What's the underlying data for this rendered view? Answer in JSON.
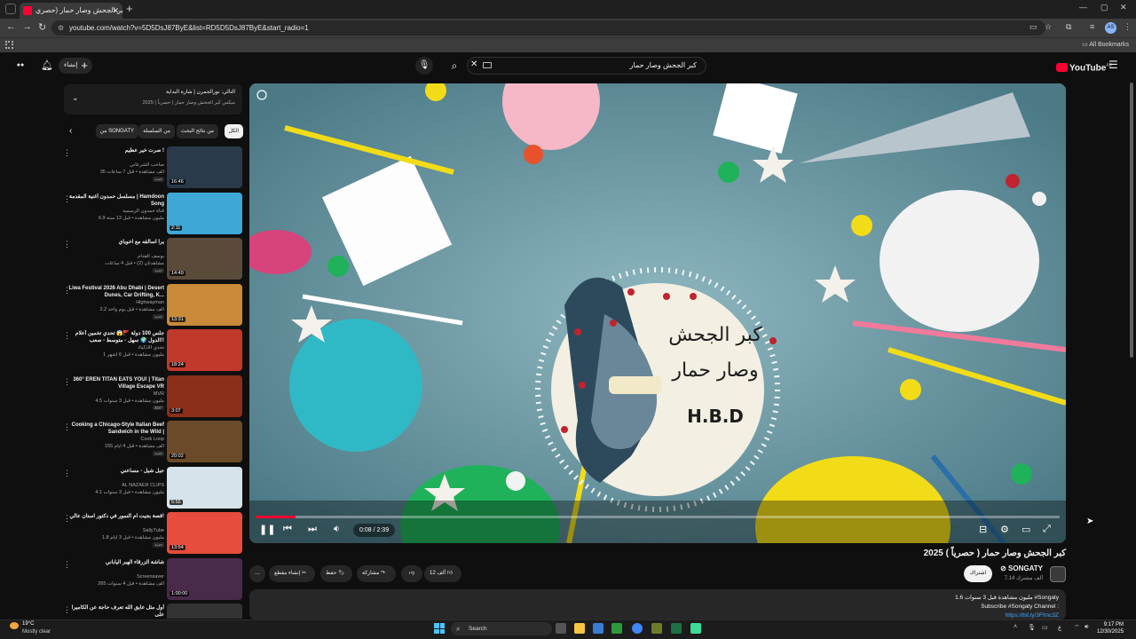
{
  "browser": {
    "tab_title": "كبر الجحش وصار حمار (حصري",
    "url": "youtube.com/watch?v=5D5DsJ87ByE&list=RD5D5DsJ87ByE&start_radio=1",
    "bookmarks_label": "All Bookmarks",
    "profile_initials": "AS"
  },
  "header": {
    "create_label": "إنشاء",
    "search_query": "كبر الجحش وصار حمار",
    "logo_text": "YouTube",
    "logo_region": "AE"
  },
  "playlist": {
    "now_playing": "التالي: نورالجمرن | شارة البداية",
    "mix_title": "ميكس كبر الجحش وصار حمار ( حصرياً ) 2025"
  },
  "chips": [
    "الكل",
    "من نتائج البحث",
    "من السلسلة",
    "من SONGATY"
  ],
  "videos": [
    {
      "title": "صرت خير عظيم !",
      "channel": "صاحب الشرعاني",
      "meta": "35 ألف مشاهدة • قبل 7 ساعات",
      "badge": "جديد",
      "duration": "16:46",
      "thumb": "#2a3a4a"
    },
    {
      "title": "مسلسل حمدون أغنية المقدمة | Hamdoon Song",
      "channel": "قناة حمدون الرسمية",
      "meta": "6.9 مليون مشاهدة • قبل 13 سنة",
      "badge": "",
      "duration": "2:11",
      "thumb": "#3fa7d6"
    },
    {
      "title": "يرا اسالقه مع اخوياي",
      "channel": "يوسف القدام",
      "meta": "مشاهدتان (2) • قبل 4 ساعات",
      "badge": "جديد",
      "duration": "14:49",
      "thumb": "#5a4a3a"
    },
    {
      "title": "Liwa Festival 2026 Abu Dhabi | Desert Dunes, Car Drifting, K...",
      "channel": "Highwayman",
      "meta": "2.2 ألف مشاهدة • قبل يوم واحد",
      "badge": "جديد",
      "duration": "13:31",
      "thumb": "#c98a3a"
    },
    {
      "title": "جلس 100 دولة 🚩😱 تحدي تخمين أعلام الدول 🌍 سهل - متوسط - صعب!!",
      "channel": "تحدي الأذكياء",
      "meta": "1 مليون مشاهدة • قبل 6 أشهر",
      "badge": "",
      "duration": "18:24",
      "thumb": "#c0392b"
    },
    {
      "title": "360° EREN TITAN EATS YOU! | Titan Village Escape VR",
      "channel": "MVR",
      "meta": "4.5 مليون مشاهدة • قبل 3 سنوات",
      "badge": "360°",
      "duration": "3:07",
      "thumb": "#8b2e1a"
    },
    {
      "title": "Cooking a Chicago-Style Italian Beef Sandwich in the Wild |",
      "channel": "Cook Loop",
      "meta": "155 ألف مشاهدة • قبل 4 أيام",
      "badge": "جديد",
      "duration": "20:02",
      "thumb": "#6b4a2a"
    },
    {
      "title": "جيل شيل - مساعني",
      "channel": "AL NAZAER CLIPS",
      "meta": "4.1 مليون مشاهدة • قبل 3 سنوات",
      "badge": "",
      "duration": "5:55",
      "thumb": "#d7e3ea"
    },
    {
      "title": "قصة بجيت ام النمور في دكتور استان عالي!",
      "channel": "SallyTube",
      "meta": "1.8 مليون مشاهدة • قبل 3 أيام",
      "badge": "جديد",
      "duration": "13:54",
      "thumb": "#e74c3c"
    },
    {
      "title": "شاشة الزرقاء الهبر الياباني",
      "channel": "Screensaver",
      "meta": "265 ألف مشاهدة • قبل 4 سنوات",
      "badge": "",
      "duration": "1:00:00",
      "thumb": "#4a2a4a"
    },
    {
      "title": "أول مثل عايق الله تعرف حاجة عن الكاميرا على",
      "channel": "",
      "meta": "",
      "badge": "",
      "duration": "",
      "thumb": "#333333"
    }
  ],
  "player": {
    "current_time": "0:08",
    "total_time": "2:39",
    "progress_fraction": 0.05,
    "cake_text_line1": "كبر الجحش",
    "cake_text_line2": "وصار حمار",
    "cake_text_line3": "H.B.D"
  },
  "video": {
    "title": "كبر الجحش وصار حمار ( حصرياً ) 2025",
    "channel_name": "SONGATY",
    "subscribers": "7.14 ألف مشترك",
    "subscribe_label": "اشتراك",
    "like_count": "12 ألف",
    "share_label": "مشاركة",
    "save_label": "حفظ",
    "clip_label": "إنشاء مقطع"
  },
  "description": {
    "line1": "1.6 مليون مشاهدة قبل 3 سنوات #Songaty",
    "line2": "Subscribe #Songaty Channel :",
    "line3": "https://bit.ly/3Ffmc3Z"
  },
  "taskbar": {
    "temperature": "19°C",
    "condition": "Mostly clear",
    "search_label": "Search",
    "time": "9:17 PM",
    "date": "12/30/2025"
  },
  "colors": {
    "accent": "#ff0033",
    "background": "#0f0f0f"
  }
}
